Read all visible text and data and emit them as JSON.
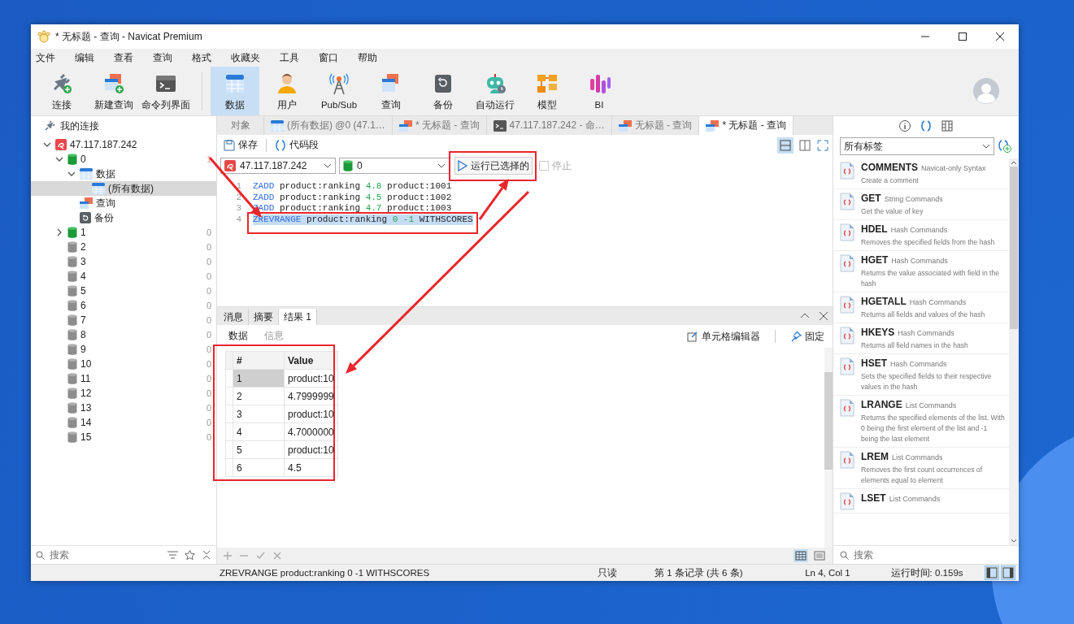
{
  "window": {
    "title": "* 无标题 - 查询 - Navicat Premium"
  },
  "menu": [
    "文件",
    "编辑",
    "查看",
    "查询",
    "格式",
    "收藏夹",
    "工具",
    "窗口",
    "帮助"
  ],
  "toolbar_left": [
    {
      "label": "连接",
      "kind": "connect",
      "selected": false
    },
    {
      "label": "新建查询",
      "kind": "new-query",
      "selected": false
    },
    {
      "label": "命令列界面",
      "kind": "console",
      "selected": false
    }
  ],
  "toolbar_main": [
    {
      "label": "数据",
      "kind": "data",
      "selected": true
    },
    {
      "label": "用户",
      "kind": "user",
      "selected": false
    },
    {
      "label": "Pub/Sub",
      "kind": "pubsub",
      "selected": false
    },
    {
      "label": "查询",
      "kind": "query",
      "selected": false
    },
    {
      "label": "备份",
      "kind": "backup",
      "selected": false
    },
    {
      "label": "自动运行",
      "kind": "robot",
      "selected": false
    },
    {
      "label": "模型",
      "kind": "model",
      "selected": false
    },
    {
      "label": "BI",
      "kind": "bi",
      "selected": false
    }
  ],
  "sidebar": {
    "title": "我的连接",
    "search_placeholder": "搜索",
    "tree": [
      {
        "label": "47.117.187.242",
        "kind": "server",
        "expanded": true,
        "selected": false,
        "children": [
          {
            "label": "0",
            "kind": "db",
            "open": true,
            "count": "1",
            "expanded": true,
            "selected": false,
            "children": [
              {
                "label": "数据",
                "kind": "data",
                "expanded": true,
                "selected": false,
                "children": [
                  {
                    "label": "(所有数据)",
                    "kind": "data",
                    "selected": true
                  }
                ]
              },
              {
                "label": "查询",
                "kind": "query",
                "selected": false
              },
              {
                "label": "备份",
                "kind": "backup",
                "selected": false
              }
            ]
          },
          {
            "label": "1",
            "kind": "db",
            "open": true,
            "count": "0",
            "expanded": false,
            "selected": false
          },
          {
            "label": "2",
            "kind": "db",
            "open": false,
            "count": "0",
            "selected": false
          },
          {
            "label": "3",
            "kind": "db",
            "open": false,
            "count": "0",
            "selected": false
          },
          {
            "label": "4",
            "kind": "db",
            "open": false,
            "count": "0",
            "selected": false
          },
          {
            "label": "5",
            "kind": "db",
            "open": false,
            "count": "0",
            "selected": false
          },
          {
            "label": "6",
            "kind": "db",
            "open": false,
            "count": "0",
            "selected": false
          },
          {
            "label": "7",
            "kind": "db",
            "open": false,
            "count": "0",
            "selected": false
          },
          {
            "label": "8",
            "kind": "db",
            "open": false,
            "count": "0",
            "selected": false
          },
          {
            "label": "9",
            "kind": "db",
            "open": false,
            "count": "0",
            "selected": false
          },
          {
            "label": "10",
            "kind": "db",
            "open": false,
            "count": "0",
            "selected": false
          },
          {
            "label": "11",
            "kind": "db",
            "open": false,
            "count": "0",
            "selected": false
          },
          {
            "label": "12",
            "kind": "db",
            "open": false,
            "count": "0",
            "selected": false
          },
          {
            "label": "13",
            "kind": "db",
            "open": false,
            "count": "0",
            "selected": false
          },
          {
            "label": "14",
            "kind": "db",
            "open": false,
            "count": "0",
            "selected": false
          },
          {
            "label": "15",
            "kind": "db",
            "open": false,
            "count": "0",
            "selected": false
          }
        ]
      }
    ]
  },
  "tabs": [
    {
      "label": "对象",
      "kind": "object",
      "selected": false
    },
    {
      "label": "(所有数据) @0 (47.1…",
      "kind": "data",
      "selected": false
    },
    {
      "label": "* 无标题 - 查询",
      "kind": "query",
      "selected": false
    },
    {
      "label": "47.117.187.242 - 命…",
      "kind": "console",
      "selected": false
    },
    {
      "label": "无标题 - 查询",
      "kind": "query",
      "selected": false
    },
    {
      "label": "* 无标题 - 查询",
      "kind": "query",
      "selected": true
    }
  ],
  "editor_toolbar": {
    "save": "保存",
    "snippet": "代码段"
  },
  "connection": {
    "server": "47.117.187.242",
    "database": "0",
    "run": "运行已选择的",
    "stop": "停止",
    "stop_disabled": true
  },
  "editor": {
    "lines": [
      {
        "number": "1",
        "selected": false,
        "tokens": [
          {
            "text": "ZADD",
            "kind": "keyword"
          },
          {
            "text": " product:ranking ",
            "kind": "plain"
          },
          {
            "text": "4.8",
            "kind": "number"
          },
          {
            "text": " product:1001",
            "kind": "plain"
          }
        ]
      },
      {
        "number": "2",
        "selected": false,
        "tokens": [
          {
            "text": "ZADD",
            "kind": "keyword"
          },
          {
            "text": " product:ranking ",
            "kind": "plain"
          },
          {
            "text": "4.5",
            "kind": "number"
          },
          {
            "text": " product:1002",
            "kind": "plain"
          }
        ]
      },
      {
        "number": "3",
        "selected": false,
        "tokens": [
          {
            "text": "ZADD",
            "kind": "keyword"
          },
          {
            "text": " product:ranking ",
            "kind": "plain"
          },
          {
            "text": "4.7",
            "kind": "number"
          },
          {
            "text": " product:1003",
            "kind": "plain"
          }
        ]
      },
      {
        "number": "4",
        "selected": true,
        "tokens": [
          {
            "text": "ZREVRANGE",
            "kind": "keyword"
          },
          {
            "text": " product:ranking ",
            "kind": "plain"
          },
          {
            "text": "0 -1",
            "kind": "number"
          },
          {
            "text": " WITHSCORES",
            "kind": "plain"
          }
        ]
      }
    ]
  },
  "results": {
    "tabs": [
      {
        "label": "消息",
        "selected": false
      },
      {
        "label": "摘要",
        "selected": false
      },
      {
        "label": "结果 1",
        "selected": true
      }
    ],
    "subtabs": [
      {
        "label": "数据",
        "selected": true
      },
      {
        "label": "信息",
        "selected": false
      }
    ],
    "actions": {
      "cell_editor": "单元格编辑器",
      "pin": "固定"
    },
    "columns": [
      "#",
      "Value"
    ],
    "rows": [
      {
        "cells": [
          "1",
          "product:10"
        ],
        "selected": true
      },
      {
        "cells": [
          "2",
          "4.7999999"
        ],
        "selected": false
      },
      {
        "cells": [
          "3",
          "product:10"
        ],
        "selected": false
      },
      {
        "cells": [
          "4",
          "4.7000000"
        ],
        "selected": false
      },
      {
        "cells": [
          "5",
          "product:10"
        ],
        "selected": false
      },
      {
        "cells": [
          "6",
          "4.5"
        ],
        "selected": false
      }
    ]
  },
  "snippets_panel": {
    "panel_tabs": [
      {
        "kind": "info",
        "selected": false
      },
      {
        "kind": "snippets",
        "selected": true
      },
      {
        "kind": "columns",
        "selected": false
      }
    ],
    "tag_filter": "所有标签",
    "search_placeholder": "搜索",
    "items": [
      {
        "name": "COMMENTS",
        "category": "Navicat-only Syntax",
        "description": "Create a comment"
      },
      {
        "name": "GET",
        "category": "String Commands",
        "description": "Get the value of key"
      },
      {
        "name": "HDEL",
        "category": "Hash Commands",
        "description": "Removes the specified fields from the hash"
      },
      {
        "name": "HGET",
        "category": "Hash Commands",
        "description": "Returns the value associated with field in the hash"
      },
      {
        "name": "HGETALL",
        "category": "Hash Commands",
        "description": "Returns all fields and values of the hash"
      },
      {
        "name": "HKEYS",
        "category": "Hash Commands",
        "description": "Returns all field names in the hash"
      },
      {
        "name": "HSET",
        "category": "Hash Commands",
        "description": "Sets the specified fields to their respective values in the hash"
      },
      {
        "name": "LRANGE",
        "category": "List Commands",
        "description": "Returns the specified elements of the list. With 0 being the first element of the list and -1 being the last element"
      },
      {
        "name": "LREM",
        "category": "List Commands",
        "description": "Removes the first count occurrences of elements equal to element"
      },
      {
        "name": "LSET",
        "category": "List Commands"
      }
    ]
  },
  "status_bar": {
    "query": "ZREVRANGE product:ranking 0 -1 WITHSCORES",
    "mode": "只读",
    "record": "第 1 条记录 (共 6 条)",
    "position": "Ln 4, Col 1",
    "elapsed": "运行时间: 0.159s"
  }
}
